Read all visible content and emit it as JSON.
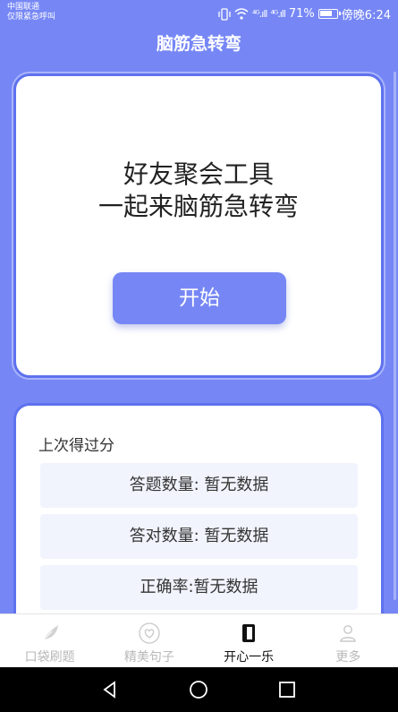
{
  "status_bar": {
    "carrier_line1": "中国联通",
    "carrier_line2": "仅限紧急呼叫",
    "signal_text": "⁴ᴳ.ıll",
    "signal_text2": "⁴ᴳ.ıll",
    "battery_percent": "71%",
    "time": "傍晚6:24"
  },
  "header": {
    "title": "脑筋急转弯"
  },
  "hero": {
    "line1": "好友聚会工具",
    "line2": "一起来脑筋急转弯",
    "start_label": "开始"
  },
  "score": {
    "heading": "上次得过分",
    "rows": [
      "答题数量: 暂无数据",
      "答对数量: 暂无数据",
      "正确率:暂无数据"
    ]
  },
  "tabs": [
    {
      "label": "口袋刷题",
      "icon": "feather-icon"
    },
    {
      "label": "精美句子",
      "icon": "heart-icon"
    },
    {
      "label": "开心一乐",
      "icon": "book-icon"
    },
    {
      "label": "更多",
      "icon": "person-icon"
    }
  ],
  "active_tab": "开心一乐",
  "colors": {
    "primary": "#7687f5",
    "card_border": "#5e71ee",
    "row_bg": "#f1f4fd"
  }
}
